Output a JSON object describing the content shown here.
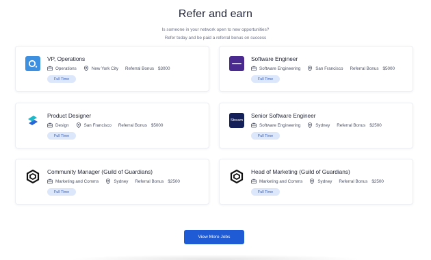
{
  "page": {
    "title": "Refer and earn",
    "subtitle_line1": "Is someone in your network open to new opportunities?",
    "subtitle_line2": "Refer today and be paid a referral bonus on success",
    "view_more_label": "View More Jobs"
  },
  "jobs": [
    {
      "title": "VP, Operations",
      "department": "Operations",
      "location": "New York City",
      "bonus_label": "Referral Bonus",
      "bonus": "$3000",
      "type": "Full Time",
      "logo": "o-letter-logo",
      "logo_color": "#3d8fe0"
    },
    {
      "title": "Software Engineer",
      "department": "Software Engineering",
      "location": "San Francisco",
      "bonus_label": "Referral Bonus",
      "bonus": "$5000",
      "type": "Full Time",
      "logo": "wordmark-logo",
      "logo_color": "#4a2a8f"
    },
    {
      "title": "Product Designer",
      "department": "Design",
      "location": "San Francisco",
      "bonus_label": "Referral Bonus",
      "bonus": "$5000",
      "type": "Full Time",
      "logo": "chain-links-logo",
      "logo_color": "#1eb8c8"
    },
    {
      "title": "Senior Software Engineer",
      "department": "Software Engineering",
      "location": "Sydney",
      "bonus_label": "Referral Bonus",
      "bonus": "$2500",
      "type": "Full Time",
      "logo": "stream-logo",
      "logo_color": "#14205a",
      "logo_text": "Stream"
    },
    {
      "title": "Community Manager (Guild of Guardians)",
      "department": "Marketing and Comms",
      "location": "Sydney",
      "bonus_label": "Referral Bonus",
      "bonus": "$2500",
      "type": "Full Time",
      "logo": "hexagon-logo",
      "logo_color": "#111111"
    },
    {
      "title": "Head of Marketing (Guild of Guardians)",
      "department": "Marketing and Comms",
      "location": "Sydney",
      "bonus_label": "Referral Bonus",
      "bonus": "$2500",
      "type": "Full Time",
      "logo": "hexagon-logo",
      "logo_color": "#111111"
    }
  ],
  "colors": {
    "accent": "#1f5bd4",
    "badge_bg": "#dde7fb",
    "badge_text": "#3b62b6"
  }
}
